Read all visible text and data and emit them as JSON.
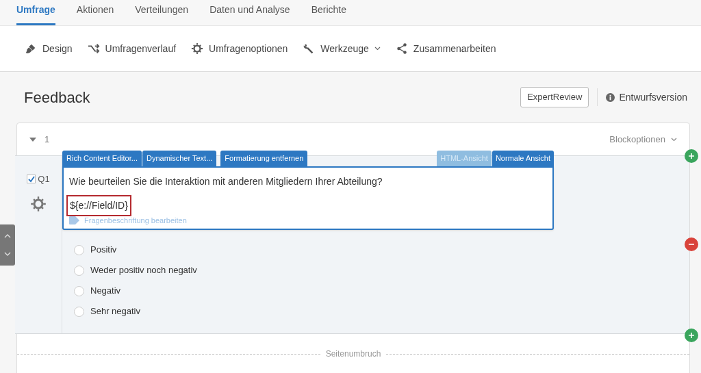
{
  "nav_tabs": [
    {
      "label": "Umfrage",
      "selected": true
    },
    {
      "label": "Aktionen",
      "selected": false
    },
    {
      "label": "Verteilungen",
      "selected": false
    },
    {
      "label": "Daten und Analyse",
      "selected": false
    },
    {
      "label": "Berichte",
      "selected": false
    }
  ],
  "toolbar": [
    {
      "label": "Design",
      "dropdown": false
    },
    {
      "label": "Umfragenverlauf",
      "dropdown": false
    },
    {
      "label": "Umfragenoptionen",
      "dropdown": false
    },
    {
      "label": "Werkzeuge",
      "dropdown": true
    },
    {
      "label": "Zusammenarbeiten",
      "dropdown": false
    }
  ],
  "survey": {
    "title": "Feedback",
    "expert_review": "ExpertReview",
    "status": "Entwurfsversion"
  },
  "block": {
    "number": "1",
    "expanded": true,
    "options": "Blockoptionen"
  },
  "question": {
    "id": "Q1",
    "checked": true,
    "editor_tabs": [
      {
        "label": "Rich Content Editor..."
      },
      {
        "label": "Dynamischer Text..."
      },
      {
        "label": "Formatierung entfernen"
      }
    ],
    "view_tabs": [
      {
        "label": "HTML-Ansicht",
        "selected": false
      },
      {
        "label": "Normale Ansicht",
        "selected": true
      }
    ],
    "text": "Wie beurteilen Sie die Interaktion mit anderen Mitgliedern Ihrer Abteilung?",
    "field_code": "${e://Field/ID}",
    "label_hint": "Fragenbeschriftung bearbeiten",
    "choices": [
      {
        "label": "Positiv",
        "selected": false
      },
      {
        "label": "Weder positiv noch negativ",
        "selected": false
      },
      {
        "label": "Negativ",
        "selected": false
      },
      {
        "label": "Sehr negativ",
        "selected": false
      }
    ]
  },
  "page_break": "Seitenumbruch"
}
